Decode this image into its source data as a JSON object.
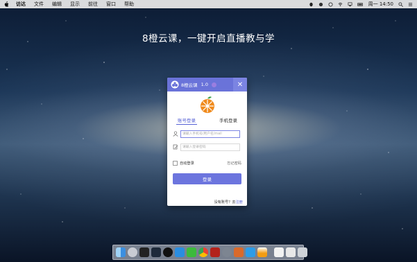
{
  "menubar": {
    "app_name": "访达",
    "items": [
      "文件",
      "编辑",
      "显示",
      "前往",
      "窗口",
      "帮助"
    ],
    "clock": "周一 14:50"
  },
  "slogan": "8橙云课，一键开启直播教与学",
  "login_window": {
    "title": "8橙云课",
    "version": "1.0",
    "close_glyph": "✕",
    "tabs": [
      "账号登录",
      "手机登录"
    ],
    "account_placeholder": "请输入手机号/用户名/mail",
    "password_placeholder": "请输入登录密码",
    "auto_login_label": "自动登录",
    "forgot_password_label": "忘记密码",
    "login_button": "登录",
    "no_account_text": "没有账号？去",
    "register_link": "注册"
  },
  "colors": {
    "accent": "#6c75de",
    "titlebar": "#6a73d9",
    "orange": "#f08a1c"
  },
  "dock": {
    "icons": [
      "finder-icon",
      "launchpad-icon",
      "terminal-icon",
      "monitor-icon",
      "qq-icon",
      "vscode-icon",
      "wechat-icon",
      "chrome-icon",
      "filezilla-icon",
      "disk-utility-icon",
      "app-store-icon",
      "kugou-icon",
      "vlc-icon",
      "documents-icon",
      "downloads-icon",
      "trash-icon"
    ]
  }
}
